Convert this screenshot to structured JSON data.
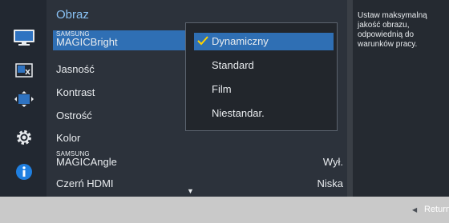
{
  "menu": {
    "title": "Obraz",
    "items": [
      {
        "label_small": "SAMSUNG",
        "label_big": "MAGIC",
        "label": "Bright",
        "value": ""
      },
      {
        "label": "Jasność",
        "value": ""
      },
      {
        "label": "Kontrast",
        "value": ""
      },
      {
        "label": "Ostrość",
        "value": ""
      },
      {
        "label": "Kolor",
        "value": ""
      },
      {
        "label_small": "SAMSUNG",
        "label_big": "MAGIC",
        "label": "Angle",
        "value": "Wył."
      },
      {
        "label": "Czerń HDMI",
        "value": "Niska"
      }
    ]
  },
  "dropdown": {
    "options": [
      "Dynamiczny",
      "Standard",
      "Film",
      "Niestandar."
    ],
    "selected": "Dynamiczny"
  },
  "info": {
    "text": "Ustaw maksymalną jakość obrazu, odpowiednią do warunków pracy."
  },
  "footer": {
    "return_label": "Return"
  },
  "icons": [
    "monitor-icon",
    "picture-size-icon",
    "position-icon",
    "gear-icon",
    "info-icon"
  ],
  "colors": {
    "accent": "#2f6fb4",
    "title": "#8ac3f6",
    "check": "#ffd400"
  }
}
